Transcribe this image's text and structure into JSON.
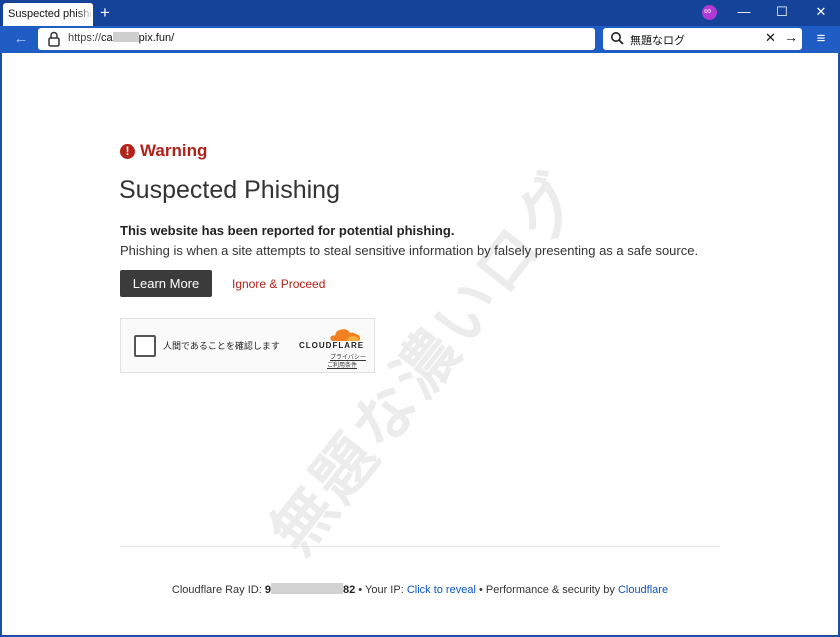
{
  "browser": {
    "tab_title": "Suspected phishi",
    "new_tab": "+",
    "window_controls": {
      "minimize": "—",
      "maximize": "☐",
      "close": "✕"
    },
    "url_scheme": "https://",
    "url_prefix": "ca",
    "url_suffix": "pix.fun/",
    "search_value": "無題なログ",
    "search_clear": "✕",
    "search_go": "→",
    "menu": "≡",
    "back": "←"
  },
  "page": {
    "warning_label": "Warning",
    "title": "Suspected Phishing",
    "description_bold": "This website has been reported for potential phishing.",
    "description": "Phishing is when a site attempts to steal sensitive information by falsely presenting as a safe source.",
    "learn_more": "Learn More",
    "ignore_proceed": "Ignore & Proceed",
    "watermark": "無題な濃いログ"
  },
  "captcha": {
    "label": "人間であることを確認します",
    "brand": "CLOUDFLARE",
    "privacy": "プライバシー",
    "terms": "ご利用条件"
  },
  "footer": {
    "ray_label": "Cloudflare Ray ID:",
    "ray_start": "9",
    "ray_end": "82",
    "sep": "•",
    "your_ip": "Your IP:",
    "click_reveal": "Click to reveal",
    "perf": "Performance & security by",
    "cloudflare": "Cloudflare"
  },
  "colors": {
    "titlebar": "#16439a",
    "toolbar": "#1f5cc4",
    "warning_red": "#b2221a",
    "link_blue": "#0b55c4",
    "button_dark": "#3b3b3b",
    "cloudflare_orange": "#f38020"
  },
  "icons": {
    "tab_close": "none",
    "lock": "lock-icon",
    "search": "search-icon",
    "warning": "exclamation-circle-icon",
    "cloud": "cloudflare-cloud-icon",
    "extension": "extension-icon"
  }
}
